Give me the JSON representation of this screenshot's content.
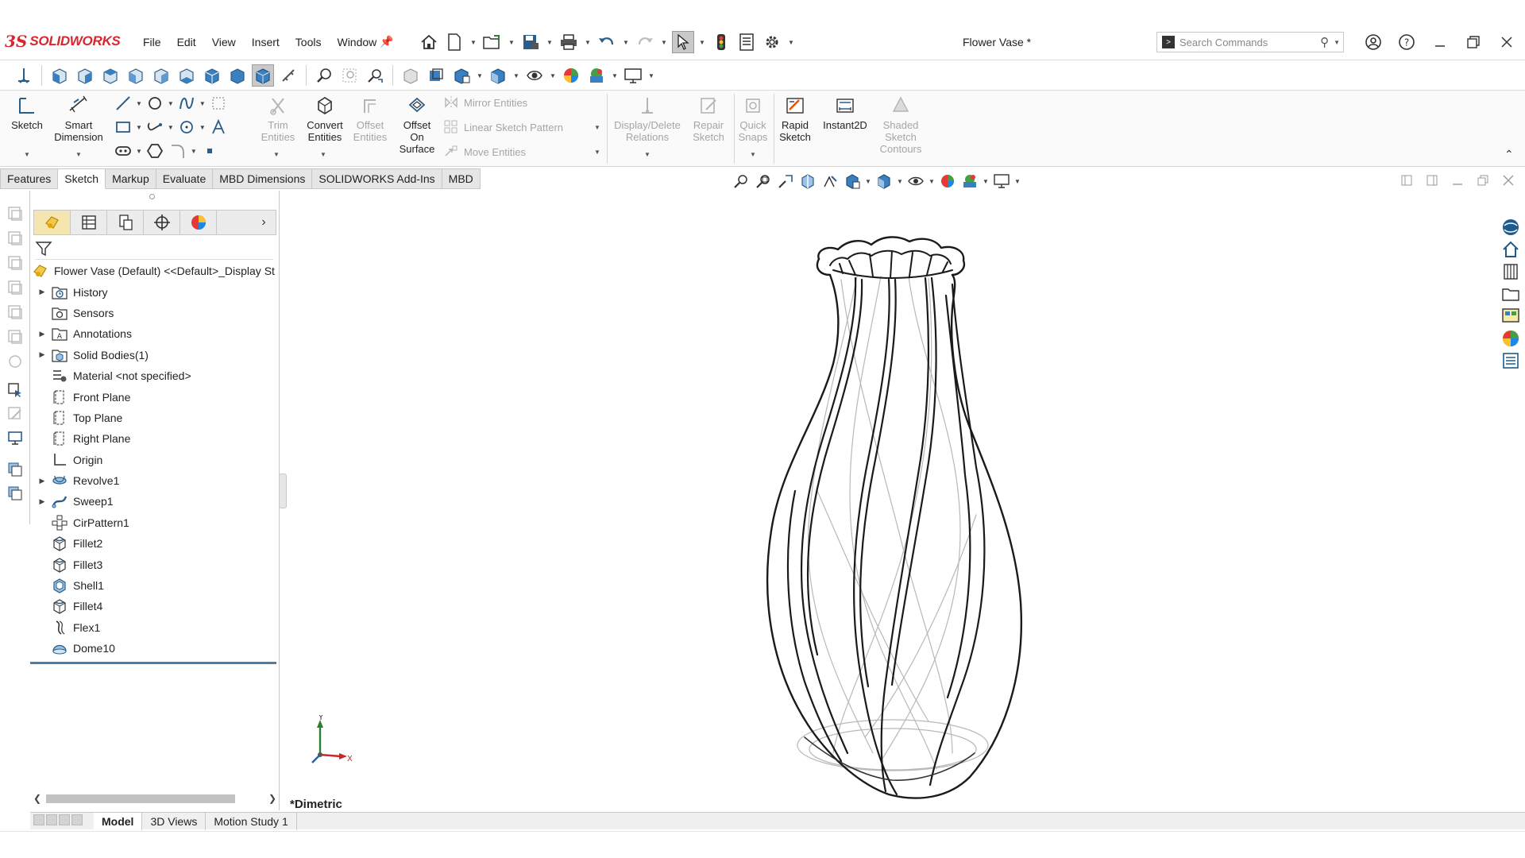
{
  "app": {
    "brand_ds": "3S",
    "brand_name": "SOLIDWORKS"
  },
  "menu": [
    "File",
    "Edit",
    "View",
    "Insert",
    "Tools",
    "Window"
  ],
  "document_title": "Flower Vase *",
  "search": {
    "placeholder": "Search Commands"
  },
  "ribbon": {
    "sketch": "Sketch",
    "smart_dimension": [
      "Smart",
      "Dimension"
    ],
    "trim_entities": [
      "Trim",
      "Entities"
    ],
    "convert_entities": [
      "Convert",
      "Entities"
    ],
    "offset_entities": [
      "Offset",
      "Entities"
    ],
    "offset_on_surface": [
      "Offset",
      "On",
      "Surface"
    ],
    "mirror_entities": "Mirror Entities",
    "linear_sketch_pattern": "Linear Sketch Pattern",
    "move_entities": "Move Entities",
    "display_delete_relations": [
      "Display/Delete",
      "Relations"
    ],
    "repair_sketch": [
      "Repair",
      "Sketch"
    ],
    "quick_snaps": [
      "Quick",
      "Snaps"
    ],
    "rapid_sketch": [
      "Rapid",
      "Sketch"
    ],
    "instant2d": "Instant2D",
    "shaded_sketch_contours": [
      "Shaded",
      "Sketch",
      "Contours"
    ]
  },
  "tabs": [
    "Features",
    "Sketch",
    "Markup",
    "Evaluate",
    "MBD Dimensions",
    "SOLIDWORKS Add-Ins",
    "MBD"
  ],
  "active_tab": "Sketch",
  "feature_tree": {
    "root": "Flower Vase (Default) <<Default>_Display St",
    "items": [
      {
        "label": "History",
        "icon": "history-folder-icon",
        "expandable": true
      },
      {
        "label": "Sensors",
        "icon": "sensors-folder-icon",
        "expandable": false
      },
      {
        "label": "Annotations",
        "icon": "annotations-folder-icon",
        "expandable": true
      },
      {
        "label": "Solid Bodies(1)",
        "icon": "solid-bodies-folder-icon",
        "expandable": true
      },
      {
        "label": "Material <not specified>",
        "icon": "material-icon",
        "expandable": false
      },
      {
        "label": "Front Plane",
        "icon": "plane-icon",
        "expandable": false
      },
      {
        "label": "Top Plane",
        "icon": "plane-icon",
        "expandable": false
      },
      {
        "label": "Right Plane",
        "icon": "plane-icon",
        "expandable": false
      },
      {
        "label": "Origin",
        "icon": "origin-icon",
        "expandable": false
      },
      {
        "label": "Revolve1",
        "icon": "revolve-icon",
        "expandable": true
      },
      {
        "label": "Sweep1",
        "icon": "sweep-icon",
        "expandable": true
      },
      {
        "label": "CirPattern1",
        "icon": "circular-pattern-icon",
        "expandable": false
      },
      {
        "label": "Fillet2",
        "icon": "fillet-icon",
        "expandable": false
      },
      {
        "label": "Fillet3",
        "icon": "fillet-icon",
        "expandable": false
      },
      {
        "label": "Shell1",
        "icon": "shell-icon",
        "expandable": false
      },
      {
        "label": "Fillet4",
        "icon": "fillet-icon",
        "expandable": false
      },
      {
        "label": "Flex1",
        "icon": "flex-icon",
        "expandable": false
      },
      {
        "label": "Dome10",
        "icon": "dome-icon",
        "expandable": false
      }
    ]
  },
  "viewport": {
    "view_name": "*Dimetric",
    "triad_x": "X",
    "triad_y": "Y"
  },
  "bottom_tabs": [
    "Model",
    "3D Views",
    "Motion Study 1"
  ],
  "active_bottom_tab": "Model",
  "colors": {
    "brand_red": "#d7262f",
    "accent_blue": "#2b6cb0",
    "tree_end_line": "#4a7fa8"
  }
}
